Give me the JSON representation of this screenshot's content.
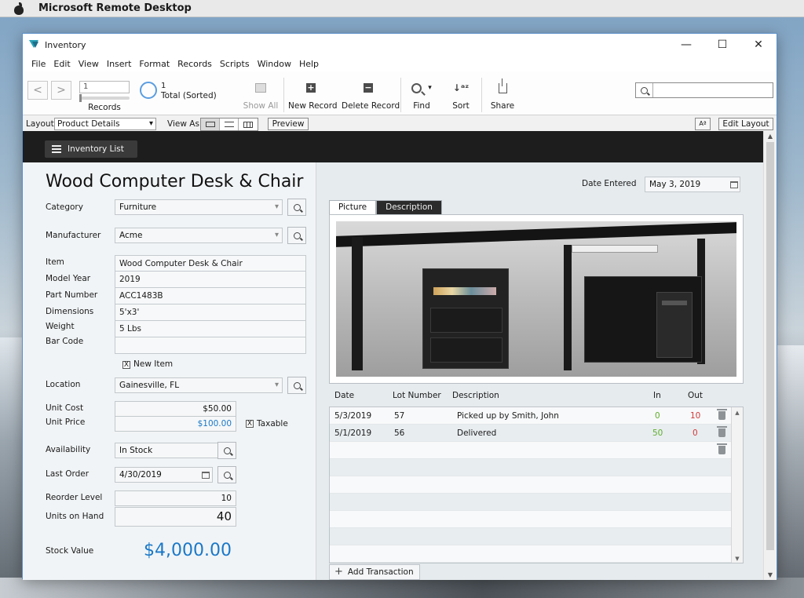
{
  "mac": {
    "app_name": "Microsoft Remote Desktop"
  },
  "window": {
    "title": "Inventory",
    "min": "—",
    "max": "☐",
    "close": "✕"
  },
  "menu": [
    "File",
    "Edit",
    "View",
    "Insert",
    "Format",
    "Records",
    "Scripts",
    "Window",
    "Help"
  ],
  "toolbar": {
    "prev": "<",
    "next": ">",
    "record_input": "1",
    "records_label": "Records",
    "total_count": "1",
    "total_label": "Total (Sorted)",
    "show_all": "Show All",
    "new_record": "New Record",
    "delete_record": "Delete Record",
    "find": "Find",
    "sort": "Sort",
    "share": "Share",
    "plus_glyph": "+",
    "minus_glyph": "−",
    "sort_glyph": "↓ᵃᶻ",
    "find_dropdown": "▾"
  },
  "layoutbar": {
    "layout_label": "Layout:",
    "layout_value": "Product Details",
    "view_as_label": "View As:",
    "preview": "Preview",
    "aa": "Aª",
    "edit_layout": "Edit Layout"
  },
  "header": {
    "inventory_list": "Inventory List"
  },
  "product": {
    "title": "Wood Computer Desk & Chair",
    "labels": {
      "category": "Category",
      "manufacturer": "Manufacturer",
      "item": "Item",
      "model_year": "Model Year",
      "part_number": "Part Number",
      "dimensions": "Dimensions",
      "weight": "Weight",
      "bar_code": "Bar Code",
      "new_item": "New Item",
      "location": "Location",
      "unit_cost": "Unit Cost",
      "unit_price": "Unit Price",
      "taxable": "Taxable",
      "availability": "Availability",
      "last_order": "Last Order",
      "reorder_level": "Reorder Level",
      "units_on_hand": "Units on Hand",
      "stock_value": "Stock Value"
    },
    "values": {
      "category": "Furniture",
      "manufacturer": "Acme",
      "item": "Wood Computer Desk & Chair",
      "model_year": "2019",
      "part_number": "ACC1483B",
      "dimensions": "5'x3'",
      "weight": "5 Lbs",
      "bar_code": "",
      "new_item_checked": "X",
      "location": "Gainesville, FL",
      "unit_cost": "$50.00",
      "unit_price": "$100.00",
      "taxable_checked": "X",
      "availability": "In Stock",
      "last_order": "4/30/2019",
      "reorder_level": "10",
      "units_on_hand": "40",
      "stock_value": "$4,000.00"
    }
  },
  "right": {
    "date_entered_label": "Date Entered",
    "date_entered": "May 3, 2019",
    "tabs": [
      "Picture",
      "Description"
    ],
    "tx_headers": {
      "date": "Date",
      "lot": "Lot Number",
      "desc": "Description",
      "in": "In",
      "out": "Out"
    },
    "transactions": [
      {
        "date": "5/3/2019",
        "lot": "57",
        "desc": "Picked up by Smith, John",
        "in": "0",
        "out": "10"
      },
      {
        "date": "5/1/2019",
        "lot": "56",
        "desc": "Delivered",
        "in": "50",
        "out": "0"
      }
    ],
    "add_transaction": "Add Transaction"
  },
  "colors": {
    "accent": "#1a78c8",
    "in_green": "#5fae2e",
    "out_red": "#d23a3a",
    "header_dark": "#1d1d1d"
  }
}
